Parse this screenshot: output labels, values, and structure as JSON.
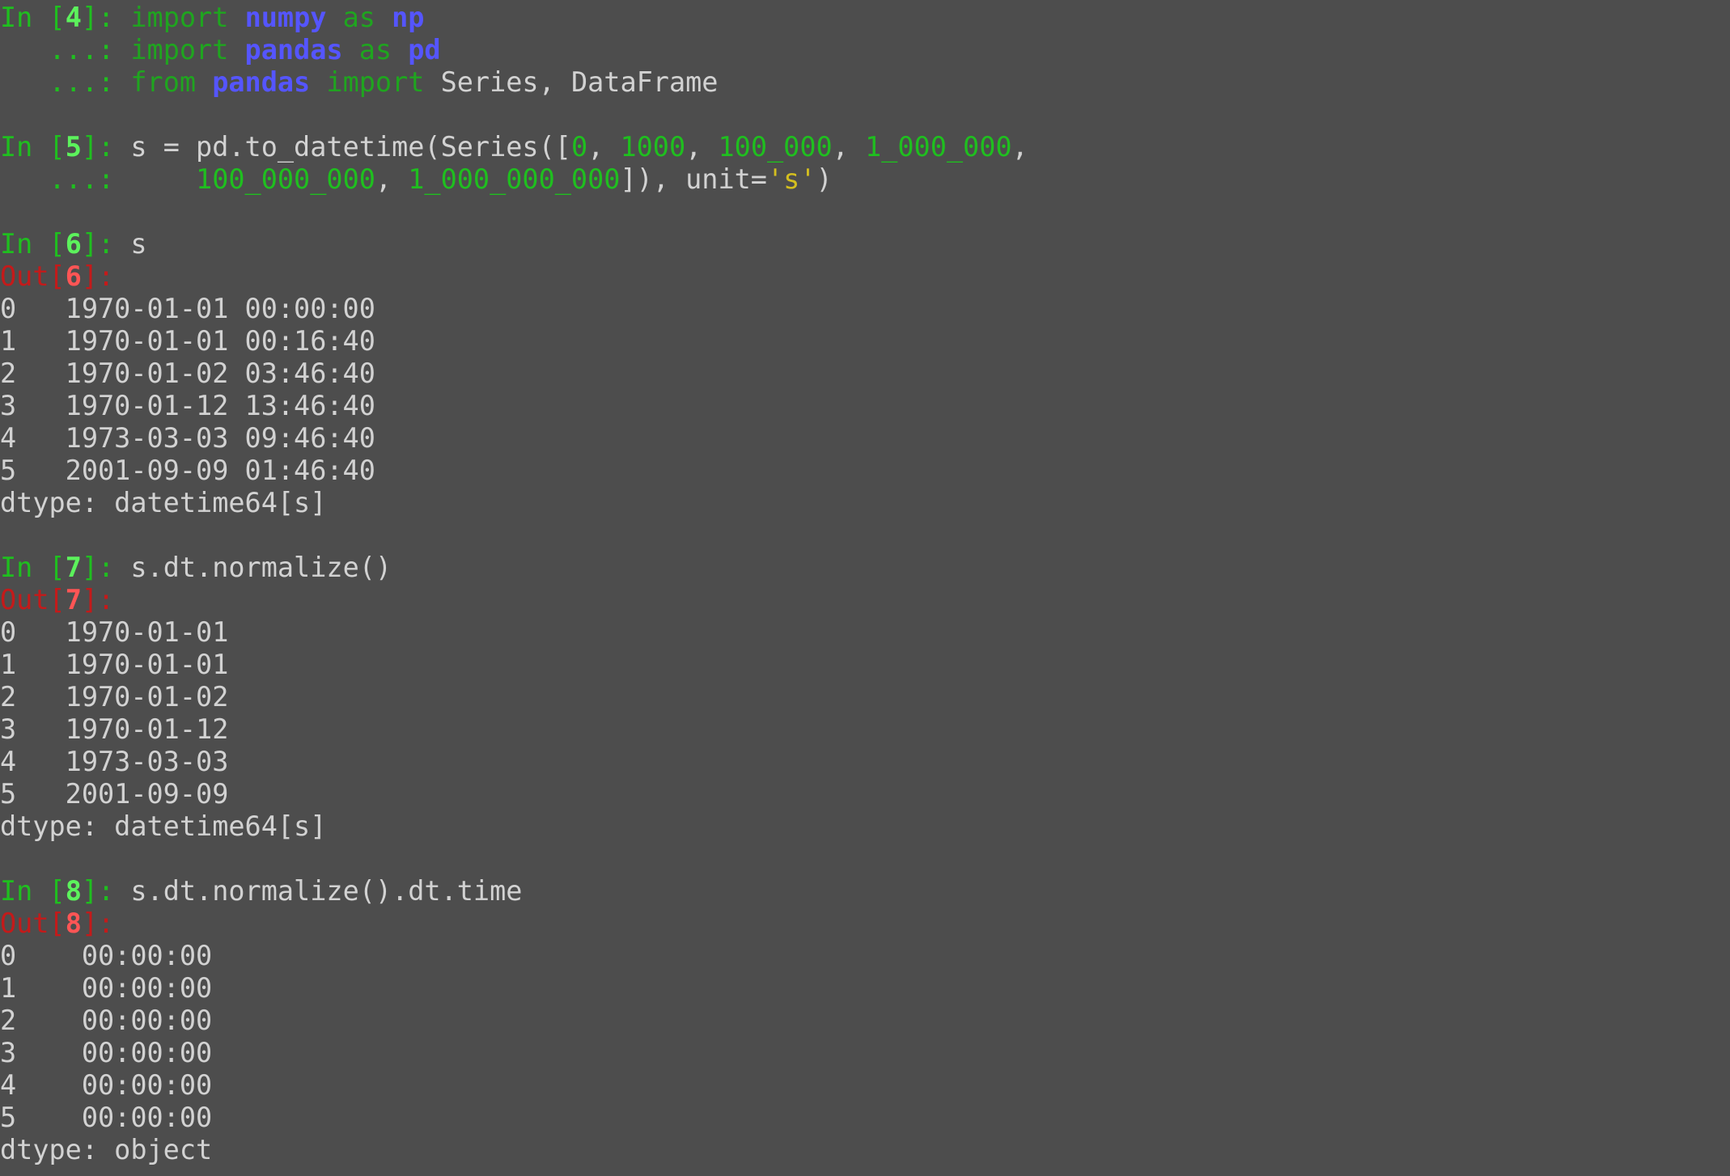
{
  "colors": {
    "background": "#4d4d4d",
    "text": "#d2d2d2",
    "prompt_in": "#1fbf1f",
    "prompt_in_number": "#5cf25c",
    "prompt_out": "#c41a1a",
    "prompt_out_number": "#ff5555",
    "keyword": "#1fa51f",
    "module": "#5555ff",
    "number": "#1fbf1f",
    "string": "#d4bf1f"
  },
  "lines": [
    [
      [
        "prompt-in",
        "In ["
      ],
      [
        "prompt-in-num",
        "4"
      ],
      [
        "prompt-in",
        "]: "
      ],
      [
        "kw",
        "import"
      ],
      [
        "txt",
        " "
      ],
      [
        "mod",
        "numpy"
      ],
      [
        "txt",
        " "
      ],
      [
        "kw",
        "as"
      ],
      [
        "txt",
        " "
      ],
      [
        "mod",
        "np"
      ]
    ],
    [
      [
        "prompt-in",
        "   ...: "
      ],
      [
        "kw",
        "import"
      ],
      [
        "txt",
        " "
      ],
      [
        "mod",
        "pandas"
      ],
      [
        "txt",
        " "
      ],
      [
        "kw",
        "as"
      ],
      [
        "txt",
        " "
      ],
      [
        "mod",
        "pd"
      ]
    ],
    [
      [
        "prompt-in",
        "   ...: "
      ],
      [
        "kw",
        "from"
      ],
      [
        "txt",
        " "
      ],
      [
        "mod",
        "pandas"
      ],
      [
        "txt",
        " "
      ],
      [
        "kw",
        "import"
      ],
      [
        "txt",
        " Series, DataFrame"
      ]
    ],
    [],
    [
      [
        "prompt-in",
        "In ["
      ],
      [
        "prompt-in-num",
        "5"
      ],
      [
        "prompt-in",
        "]: "
      ],
      [
        "txt",
        "s = pd.to_datetime(Series(["
      ],
      [
        "num",
        "0"
      ],
      [
        "txt",
        ", "
      ],
      [
        "num",
        "1000"
      ],
      [
        "txt",
        ", "
      ],
      [
        "num",
        "100_000"
      ],
      [
        "txt",
        ", "
      ],
      [
        "num",
        "1_000_000"
      ],
      [
        "txt",
        ","
      ]
    ],
    [
      [
        "prompt-in",
        "   ...: "
      ],
      [
        "txt",
        "    "
      ],
      [
        "num",
        "100_000_000"
      ],
      [
        "txt",
        ", "
      ],
      [
        "num",
        "1_000_000_000"
      ],
      [
        "txt",
        "]), unit="
      ],
      [
        "str",
        "'s'"
      ],
      [
        "txt",
        ")"
      ]
    ],
    [],
    [
      [
        "prompt-in",
        "In ["
      ],
      [
        "prompt-in-num",
        "6"
      ],
      [
        "prompt-in",
        "]: "
      ],
      [
        "txt",
        "s"
      ]
    ],
    [
      [
        "prompt-out",
        "Out["
      ],
      [
        "prompt-out-num",
        "6"
      ],
      [
        "prompt-out",
        "]:"
      ]
    ],
    [
      [
        "txt",
        "0   1970-01-01 00:00:00"
      ]
    ],
    [
      [
        "txt",
        "1   1970-01-01 00:16:40"
      ]
    ],
    [
      [
        "txt",
        "2   1970-01-02 03:46:40"
      ]
    ],
    [
      [
        "txt",
        "3   1970-01-12 13:46:40"
      ]
    ],
    [
      [
        "txt",
        "4   1973-03-03 09:46:40"
      ]
    ],
    [
      [
        "txt",
        "5   2001-09-09 01:46:40"
      ]
    ],
    [
      [
        "txt",
        "dtype: datetime64[s]"
      ]
    ],
    [],
    [
      [
        "prompt-in",
        "In ["
      ],
      [
        "prompt-in-num",
        "7"
      ],
      [
        "prompt-in",
        "]: "
      ],
      [
        "txt",
        "s.dt.normalize()"
      ]
    ],
    [
      [
        "prompt-out",
        "Out["
      ],
      [
        "prompt-out-num",
        "7"
      ],
      [
        "prompt-out",
        "]:"
      ]
    ],
    [
      [
        "txt",
        "0   1970-01-01"
      ]
    ],
    [
      [
        "txt",
        "1   1970-01-01"
      ]
    ],
    [
      [
        "txt",
        "2   1970-01-02"
      ]
    ],
    [
      [
        "txt",
        "3   1970-01-12"
      ]
    ],
    [
      [
        "txt",
        "4   1973-03-03"
      ]
    ],
    [
      [
        "txt",
        "5   2001-09-09"
      ]
    ],
    [
      [
        "txt",
        "dtype: datetime64[s]"
      ]
    ],
    [],
    [
      [
        "prompt-in",
        "In ["
      ],
      [
        "prompt-in-num",
        "8"
      ],
      [
        "prompt-in",
        "]: "
      ],
      [
        "txt",
        "s.dt.normalize().dt.time"
      ]
    ],
    [
      [
        "prompt-out",
        "Out["
      ],
      [
        "prompt-out-num",
        "8"
      ],
      [
        "prompt-out",
        "]:"
      ]
    ],
    [
      [
        "txt",
        "0    00:00:00"
      ]
    ],
    [
      [
        "txt",
        "1    00:00:00"
      ]
    ],
    [
      [
        "txt",
        "2    00:00:00"
      ]
    ],
    [
      [
        "txt",
        "3    00:00:00"
      ]
    ],
    [
      [
        "txt",
        "4    00:00:00"
      ]
    ],
    [
      [
        "txt",
        "5    00:00:00"
      ]
    ],
    [
      [
        "txt",
        "dtype: object"
      ]
    ]
  ]
}
